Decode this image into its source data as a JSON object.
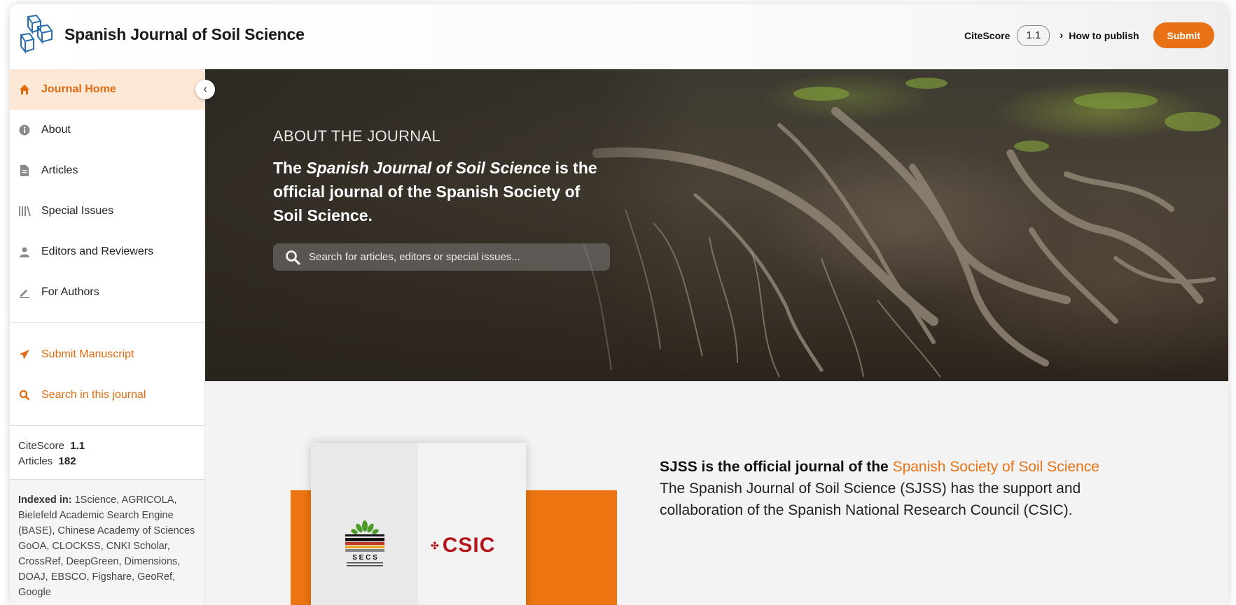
{
  "header": {
    "title": "Spanish Journal of Soil Science",
    "citescore_label": "CiteScore",
    "citescore_value": "1.1",
    "how_to_publish": "How to publish",
    "submit": "Submit"
  },
  "sidebar": {
    "items": [
      {
        "label": "Journal Home",
        "icon": "home-icon",
        "active": true
      },
      {
        "label": "About",
        "icon": "info-icon"
      },
      {
        "label": "Articles",
        "icon": "document-icon"
      },
      {
        "label": "Special Issues",
        "icon": "books-icon"
      },
      {
        "label": "Editors and Reviewers",
        "icon": "person-icon"
      },
      {
        "label": "For Authors",
        "icon": "pencil-icon"
      }
    ],
    "actions": [
      {
        "label": "Submit Manuscript",
        "icon": "paper-plane-icon"
      },
      {
        "label": "Search in this journal",
        "icon": "search-icon"
      }
    ],
    "stats": {
      "citescore_label": "CiteScore",
      "citescore_value": "1.1",
      "articles_label": "Articles",
      "articles_value": "182"
    },
    "indexed_label": "Indexed in:",
    "indexed_text": "1Science, AGRICOLA, Bielefeld Academic Search Engine (BASE), Chinese Academy of Sciences GoOA, CLOCKSS, CNKI Scholar, CrossRef, DeepGreen, Dimensions, DOAJ, EBSCO, Figshare, GeoRef, Google"
  },
  "hero": {
    "kicker": "ABOUT THE JOURNAL",
    "text_pre": "The ",
    "text_italic": "Spanish Journal of Soil Science",
    "text_post": " is the official journal of the Spanish Society of Soil Science.",
    "search_placeholder": "Search for articles, editors or special issues..."
  },
  "content": {
    "lead": "SJSS is the official journal of the ",
    "lead_link": "Spanish Society of Soil Science",
    "body": "The Spanish Journal of Soil Science (SJSS) has the support and collaboration of the Spanish National Research Council (CSIC).",
    "secs_text": "S E C S",
    "csic_text": "CSIC"
  },
  "colors": {
    "accent": "#e87116",
    "active_bg": "#fde7d5",
    "csic_red": "#b5161b"
  }
}
